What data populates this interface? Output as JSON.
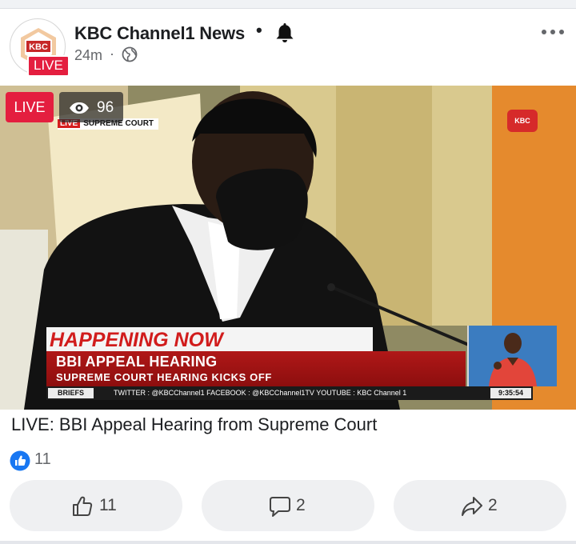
{
  "post": {
    "page_name": "KBC Channel1 News",
    "separator": "•",
    "time": "24m",
    "time_separator": "·",
    "avatar_logo_text": "KBC",
    "avatar_live_badge": "LIVE",
    "caption": "LIVE: BBI Appeal Hearing from Supreme Court",
    "reactions_count": "11"
  },
  "video": {
    "live_badge": "LIVE",
    "viewers": "96",
    "overlay_breadcrumb_live": "LIVE",
    "overlay_breadcrumb": "SUPREME COURT",
    "happening_now": "HAPPENING NOW",
    "headline": "BBI APPEAL HEARING",
    "subheadline": "SUPREME COURT HEARING KICKS OFF",
    "ticker_label": "BRIEFS",
    "ticker_text": "TWITTER : @KBCChannel1   FACEBOOK : @KBCChannel1TV   YOUTUBE : KBC Channel 1",
    "clock": "9:35:54"
  },
  "actions": {
    "like_count": "11",
    "comment_count": "2",
    "share_count": "2"
  },
  "icons": {
    "bell": "bell-icon",
    "globe": "globe-icon",
    "more": "more-options-icon",
    "eye": "eye-icon",
    "like": "thumbs-up-icon",
    "comment": "comment-icon",
    "share": "share-icon"
  },
  "colors": {
    "live_red": "#e41e3f",
    "fb_blue": "#1877f2",
    "button_bg": "#eff0f2",
    "meta_gray": "#65676b"
  }
}
